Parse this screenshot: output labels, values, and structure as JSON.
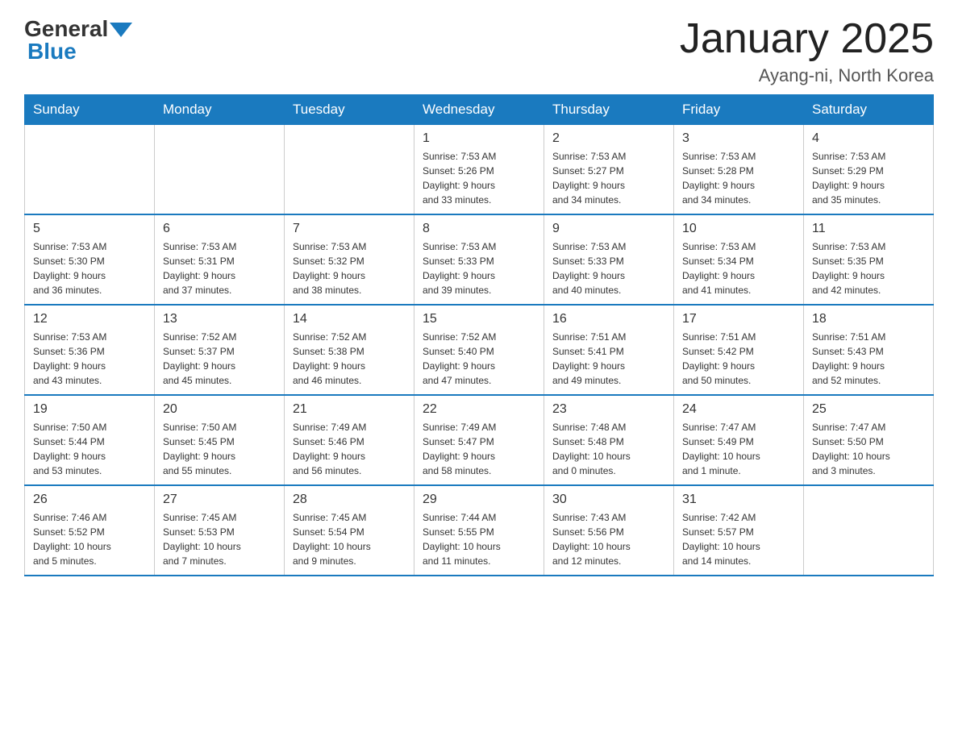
{
  "logo": {
    "general": "General",
    "blue": "Blue",
    "triangle_color": "#1a7abf"
  },
  "title": "January 2025",
  "subtitle": "Ayang-ni, North Korea",
  "days_of_week": [
    "Sunday",
    "Monday",
    "Tuesday",
    "Wednesday",
    "Thursday",
    "Friday",
    "Saturday"
  ],
  "weeks": [
    [
      {
        "day": "",
        "info": ""
      },
      {
        "day": "",
        "info": ""
      },
      {
        "day": "",
        "info": ""
      },
      {
        "day": "1",
        "info": "Sunrise: 7:53 AM\nSunset: 5:26 PM\nDaylight: 9 hours\nand 33 minutes."
      },
      {
        "day": "2",
        "info": "Sunrise: 7:53 AM\nSunset: 5:27 PM\nDaylight: 9 hours\nand 34 minutes."
      },
      {
        "day": "3",
        "info": "Sunrise: 7:53 AM\nSunset: 5:28 PM\nDaylight: 9 hours\nand 34 minutes."
      },
      {
        "day": "4",
        "info": "Sunrise: 7:53 AM\nSunset: 5:29 PM\nDaylight: 9 hours\nand 35 minutes."
      }
    ],
    [
      {
        "day": "5",
        "info": "Sunrise: 7:53 AM\nSunset: 5:30 PM\nDaylight: 9 hours\nand 36 minutes."
      },
      {
        "day": "6",
        "info": "Sunrise: 7:53 AM\nSunset: 5:31 PM\nDaylight: 9 hours\nand 37 minutes."
      },
      {
        "day": "7",
        "info": "Sunrise: 7:53 AM\nSunset: 5:32 PM\nDaylight: 9 hours\nand 38 minutes."
      },
      {
        "day": "8",
        "info": "Sunrise: 7:53 AM\nSunset: 5:33 PM\nDaylight: 9 hours\nand 39 minutes."
      },
      {
        "day": "9",
        "info": "Sunrise: 7:53 AM\nSunset: 5:33 PM\nDaylight: 9 hours\nand 40 minutes."
      },
      {
        "day": "10",
        "info": "Sunrise: 7:53 AM\nSunset: 5:34 PM\nDaylight: 9 hours\nand 41 minutes."
      },
      {
        "day": "11",
        "info": "Sunrise: 7:53 AM\nSunset: 5:35 PM\nDaylight: 9 hours\nand 42 minutes."
      }
    ],
    [
      {
        "day": "12",
        "info": "Sunrise: 7:53 AM\nSunset: 5:36 PM\nDaylight: 9 hours\nand 43 minutes."
      },
      {
        "day": "13",
        "info": "Sunrise: 7:52 AM\nSunset: 5:37 PM\nDaylight: 9 hours\nand 45 minutes."
      },
      {
        "day": "14",
        "info": "Sunrise: 7:52 AM\nSunset: 5:38 PM\nDaylight: 9 hours\nand 46 minutes."
      },
      {
        "day": "15",
        "info": "Sunrise: 7:52 AM\nSunset: 5:40 PM\nDaylight: 9 hours\nand 47 minutes."
      },
      {
        "day": "16",
        "info": "Sunrise: 7:51 AM\nSunset: 5:41 PM\nDaylight: 9 hours\nand 49 minutes."
      },
      {
        "day": "17",
        "info": "Sunrise: 7:51 AM\nSunset: 5:42 PM\nDaylight: 9 hours\nand 50 minutes."
      },
      {
        "day": "18",
        "info": "Sunrise: 7:51 AM\nSunset: 5:43 PM\nDaylight: 9 hours\nand 52 minutes."
      }
    ],
    [
      {
        "day": "19",
        "info": "Sunrise: 7:50 AM\nSunset: 5:44 PM\nDaylight: 9 hours\nand 53 minutes."
      },
      {
        "day": "20",
        "info": "Sunrise: 7:50 AM\nSunset: 5:45 PM\nDaylight: 9 hours\nand 55 minutes."
      },
      {
        "day": "21",
        "info": "Sunrise: 7:49 AM\nSunset: 5:46 PM\nDaylight: 9 hours\nand 56 minutes."
      },
      {
        "day": "22",
        "info": "Sunrise: 7:49 AM\nSunset: 5:47 PM\nDaylight: 9 hours\nand 58 minutes."
      },
      {
        "day": "23",
        "info": "Sunrise: 7:48 AM\nSunset: 5:48 PM\nDaylight: 10 hours\nand 0 minutes."
      },
      {
        "day": "24",
        "info": "Sunrise: 7:47 AM\nSunset: 5:49 PM\nDaylight: 10 hours\nand 1 minute."
      },
      {
        "day": "25",
        "info": "Sunrise: 7:47 AM\nSunset: 5:50 PM\nDaylight: 10 hours\nand 3 minutes."
      }
    ],
    [
      {
        "day": "26",
        "info": "Sunrise: 7:46 AM\nSunset: 5:52 PM\nDaylight: 10 hours\nand 5 minutes."
      },
      {
        "day": "27",
        "info": "Sunrise: 7:45 AM\nSunset: 5:53 PM\nDaylight: 10 hours\nand 7 minutes."
      },
      {
        "day": "28",
        "info": "Sunrise: 7:45 AM\nSunset: 5:54 PM\nDaylight: 10 hours\nand 9 minutes."
      },
      {
        "day": "29",
        "info": "Sunrise: 7:44 AM\nSunset: 5:55 PM\nDaylight: 10 hours\nand 11 minutes."
      },
      {
        "day": "30",
        "info": "Sunrise: 7:43 AM\nSunset: 5:56 PM\nDaylight: 10 hours\nand 12 minutes."
      },
      {
        "day": "31",
        "info": "Sunrise: 7:42 AM\nSunset: 5:57 PM\nDaylight: 10 hours\nand 14 minutes."
      },
      {
        "day": "",
        "info": ""
      }
    ]
  ]
}
